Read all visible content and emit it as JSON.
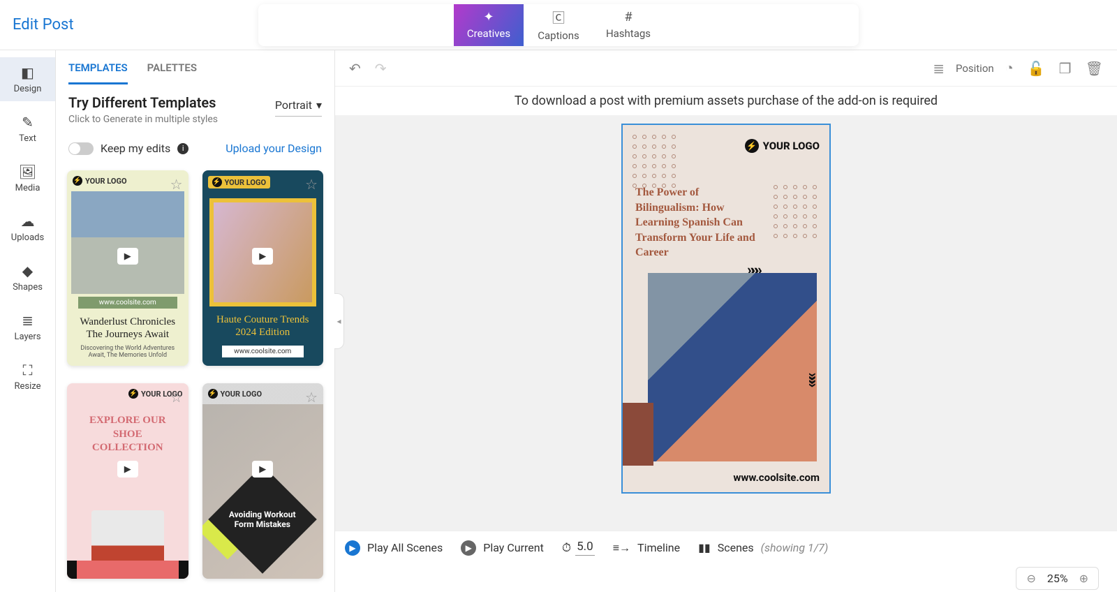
{
  "header": {
    "title": "Edit Post"
  },
  "top_tabs": {
    "creatives": "Creatives",
    "captions": "Captions",
    "hashtags": "Hashtags"
  },
  "sidenav": {
    "design": "Design",
    "text": "Text",
    "media": "Media",
    "uploads": "Uploads",
    "shapes": "Shapes",
    "layers": "Layers",
    "resize": "Resize"
  },
  "panel": {
    "tab_templates": "TEMPLATES",
    "tab_palettes": "PALETTES",
    "heading": "Try Different Templates",
    "subheading": "Click to Generate in multiple styles",
    "orientation": "Portrait",
    "keep_edits": "Keep my edits",
    "upload": "Upload your Design"
  },
  "templates": {
    "logo_text": "YOUR LOGO",
    "site": "www.coolsite.com",
    "card1_title": "Wanderlust Chronicles The Journeys Await",
    "card1_sub": "Discovering the World Adventures Await, The Memories Unfold",
    "card2_title": "Haute Couture Trends 2024 Edition",
    "card3_title": "EXPLORE OUR SHOE COLLECTION",
    "card4_title": "Avoiding Workout Form Mistakes"
  },
  "canvas": {
    "premium_msg": "To download a post with premium assets purchase of the add-on is required",
    "position": "Position",
    "design_title": "The Power of Bilingualism: How Learning Spanish Can Transform Your Life and Career",
    "design_logo": "YOUR LOGO",
    "site": "www.coolsite.com"
  },
  "bottom": {
    "play_all": "Play All Scenes",
    "play_current": "Play Current",
    "duration": "5.0",
    "timeline": "Timeline",
    "scenes": "Scenes",
    "scenes_count": "(showing 1/7)",
    "zoom": "25%"
  }
}
